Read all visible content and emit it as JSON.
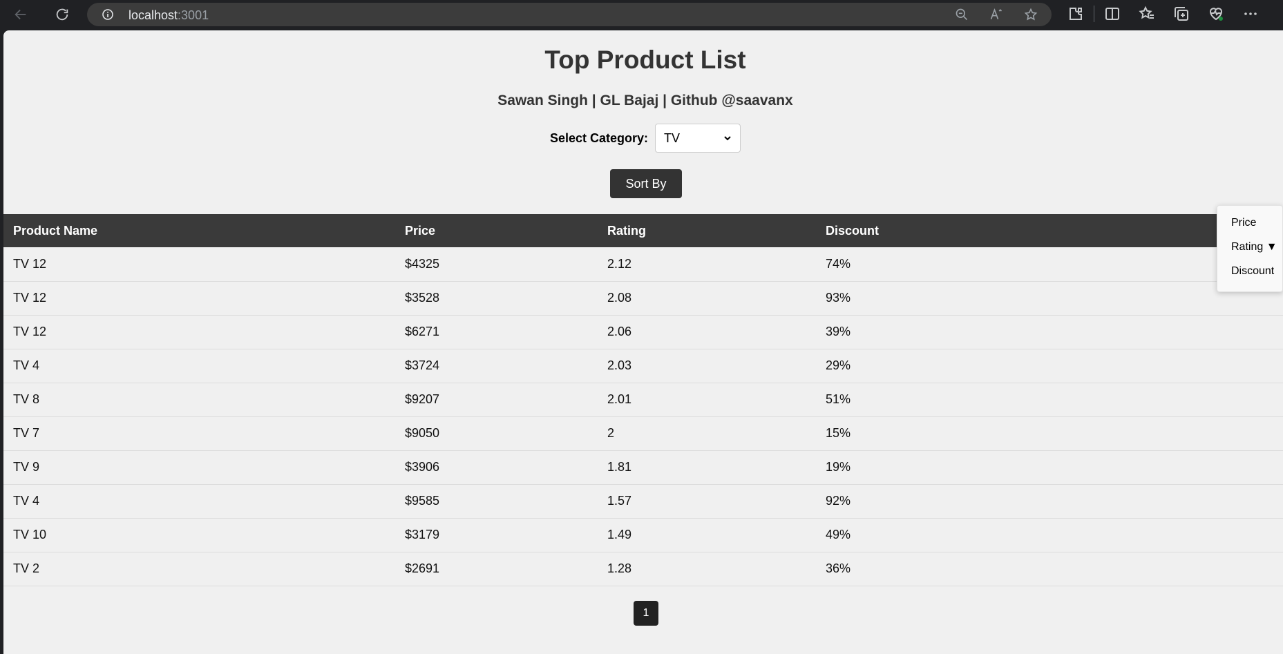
{
  "browser": {
    "url_host": "localhost",
    "url_port": ":3001"
  },
  "page": {
    "title": "Top Product List",
    "subtitle": "Sawan Singh | GL Bajaj | Github @saavanx",
    "category_label": "Select Category:",
    "category_value": "TV",
    "sort_button": "Sort By"
  },
  "table": {
    "headers": [
      "Product Name",
      "Price",
      "Rating",
      "Discount"
    ],
    "rows": [
      [
        "TV 12",
        "$4325",
        "2.12",
        "74%"
      ],
      [
        "TV 12",
        "$3528",
        "2.08",
        "93%"
      ],
      [
        "TV 12",
        "$6271",
        "2.06",
        "39%"
      ],
      [
        "TV 4",
        "$3724",
        "2.03",
        "29%"
      ],
      [
        "TV 8",
        "$9207",
        "2.01",
        "51%"
      ],
      [
        "TV 7",
        "$9050",
        "2",
        "15%"
      ],
      [
        "TV 9",
        "$3906",
        "1.81",
        "19%"
      ],
      [
        "TV 4",
        "$9585",
        "1.57",
        "92%"
      ],
      [
        "TV 10",
        "$3179",
        "1.49",
        "49%"
      ],
      [
        "TV 2",
        "$2691",
        "1.28",
        "36%"
      ]
    ]
  },
  "pagination": {
    "current": "1"
  },
  "sort_menu": {
    "options": [
      "Price",
      "Rating ▼",
      "Discount"
    ]
  }
}
